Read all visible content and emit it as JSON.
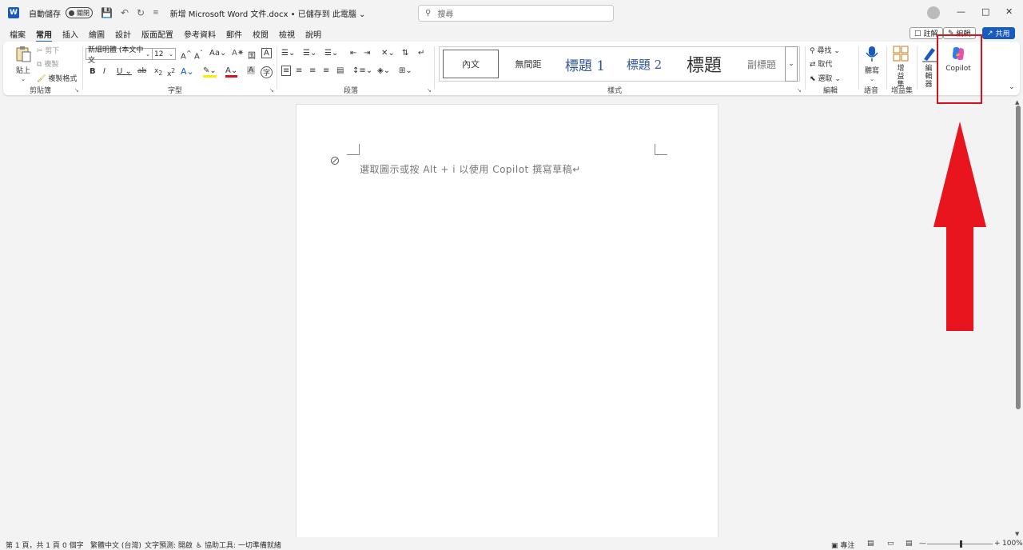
{
  "titlebar": {
    "autosave_label": "自動儲存",
    "autosave_state": "關閉",
    "doc_title": "新增 Microsoft Word 文件.docx • 已儲存到 此電腦 ⌄",
    "search_placeholder": "搜尋"
  },
  "tabs": [
    "檔案",
    "常用",
    "插入",
    "繪圖",
    "設計",
    "版面配置",
    "參考資料",
    "郵件",
    "校閱",
    "檢視",
    "說明"
  ],
  "active_tab": "常用",
  "tab_actions": {
    "comment": "註解",
    "edit": "編輯",
    "share": "共用"
  },
  "ribbon": {
    "clipboard": {
      "paste": "貼上",
      "cut": "剪下",
      "copy": "複製",
      "format_painter": "複製格式",
      "label": "剪貼簿"
    },
    "font": {
      "font_name": "新細明體 (本文中文",
      "font_size": "12",
      "label": "字型"
    },
    "paragraph": {
      "label": "段落"
    },
    "styles": {
      "items": [
        "內文",
        "無間距",
        "標題 1",
        "標題 2",
        "標題",
        "副標題"
      ],
      "label": "樣式"
    },
    "editing": {
      "find": "尋找",
      "replace": "取代",
      "select": "選取",
      "label": "編輯"
    },
    "voice": {
      "dictate": "聽寫",
      "label": "語音"
    },
    "addins": {
      "addins": "增益集",
      "label": "增益集"
    },
    "editor": {
      "label": "編輯器"
    },
    "copilot": {
      "label": "Copilot"
    }
  },
  "document": {
    "hint": "選取圖示或按 Alt + i 以使用 Copilot 撰寫草稿↵"
  },
  "statusbar": {
    "page": "第 1 頁，共 1 頁",
    "words": "0 個字",
    "language": "繁體中文 (台灣)",
    "text_prediction": "文字預測: 開啟",
    "accessibility": "協助工具: 一切準備就緒",
    "focus": "專注",
    "zoom": "100%"
  },
  "colors": {
    "accent": "#185abd",
    "annotation": "#d5121d"
  }
}
